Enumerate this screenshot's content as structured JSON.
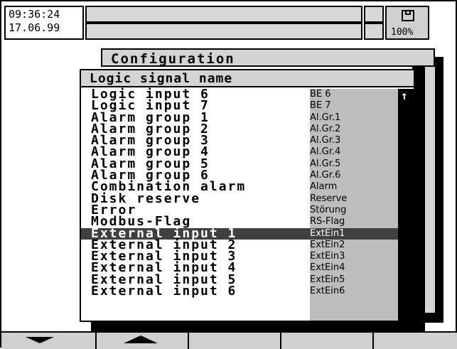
{
  "status": {
    "time": "09:36:24",
    "date": "17.06.99",
    "disk_percent": "100%"
  },
  "config_window": {
    "title": "Configuration"
  },
  "dialog": {
    "title": "Logic signal name",
    "items": [
      {
        "name": "Logic input 6",
        "code": "BE 6"
      },
      {
        "name": "Logic input 7",
        "code": "BE 7"
      },
      {
        "name": "Alarm group 1",
        "code": "Al.Gr.1"
      },
      {
        "name": "Alarm group 2",
        "code": "Al.Gr.2"
      },
      {
        "name": "Alarm group 3",
        "code": "Al.Gr.3"
      },
      {
        "name": "Alarm group 4",
        "code": "Al.Gr.4"
      },
      {
        "name": "Alarm group 5",
        "code": "Al.Gr.5"
      },
      {
        "name": "Alarm group 6",
        "code": "Al.Gr.6"
      },
      {
        "name": "Combination alarm",
        "code": "Alarm"
      },
      {
        "name": "Disk reserve",
        "code": "Reserve"
      },
      {
        "name": "Error",
        "code": "Störung"
      },
      {
        "name": "Modbus-Flag",
        "code": "RS-Flag"
      },
      {
        "name": "External input 1",
        "code": "ExtEin1"
      },
      {
        "name": "External input 2",
        "code": "ExtEin2"
      },
      {
        "name": "External input 3",
        "code": "ExtEin3"
      },
      {
        "name": "External input 4",
        "code": "ExtEin4"
      },
      {
        "name": "External input 5",
        "code": "ExtEin5"
      },
      {
        "name": "External input 6",
        "code": "ExtEin6"
      }
    ],
    "selected_index": 12
  },
  "icons": {
    "disk": "floppy-disk-icon",
    "scroll": "arrow-up-icon",
    "down": "triangle-down-icon",
    "up": "triangle-up-icon"
  }
}
